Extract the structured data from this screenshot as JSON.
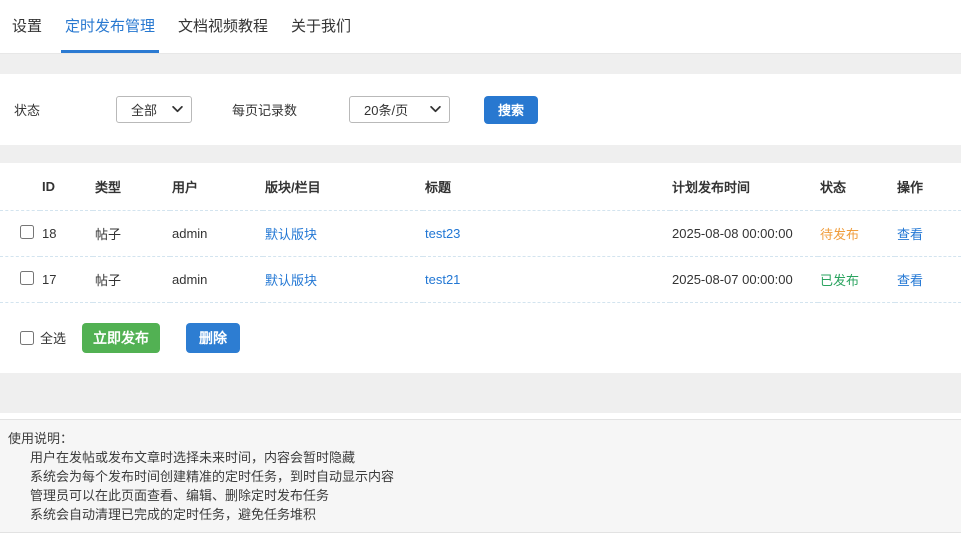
{
  "tabs": [
    {
      "label": "设置",
      "active": false
    },
    {
      "label": "定时发布管理",
      "active": true
    },
    {
      "label": "文档视频教程",
      "active": false
    },
    {
      "label": "关于我们",
      "active": false
    }
  ],
  "filters": {
    "status_label": "状态",
    "status_selected": "全部",
    "per_page_label": "每页记录数",
    "per_page_selected": "20条/页",
    "search_button": "搜索"
  },
  "table": {
    "headers": {
      "id": "ID",
      "type": "类型",
      "user": "用户",
      "board": "版块/栏目",
      "title": "标题",
      "time": "计划发布时间",
      "status": "状态",
      "action": "操作"
    },
    "rows": [
      {
        "id": "18",
        "type": "帖子",
        "user": "admin",
        "board": "默认版块",
        "title": "test23",
        "time": "2025-08-08 00:00:00",
        "status": "待发布",
        "action": "查看"
      },
      {
        "id": "17",
        "type": "帖子",
        "user": "admin",
        "board": "默认版块",
        "title": "test21",
        "time": "2025-08-07 00:00:00",
        "status": "已发布",
        "action": "查看"
      }
    ]
  },
  "bulk_actions": {
    "select_all": "全选",
    "publish_now": "立即发布",
    "delete": "删除"
  },
  "usage": {
    "title": "使用说明：",
    "lines": [
      "用户在发帖或发布文章时选择未来时间，内容会暂时隐藏",
      "系统会为每个发布时间创建精准的定时任务，到时自动显示内容",
      "管理员可以在此页面查看、编辑、删除定时发布任务",
      "系统会自动清理已完成的定时任务，避免任务堆积"
    ]
  },
  "colors": {
    "accent_blue": "#2778d0",
    "button_blue": "#2d7dd2",
    "button_green": "#52b153",
    "status_pending_orange": "#f09d3c",
    "status_published_green": "#2aa35f",
    "band_gray": "#efefef"
  }
}
